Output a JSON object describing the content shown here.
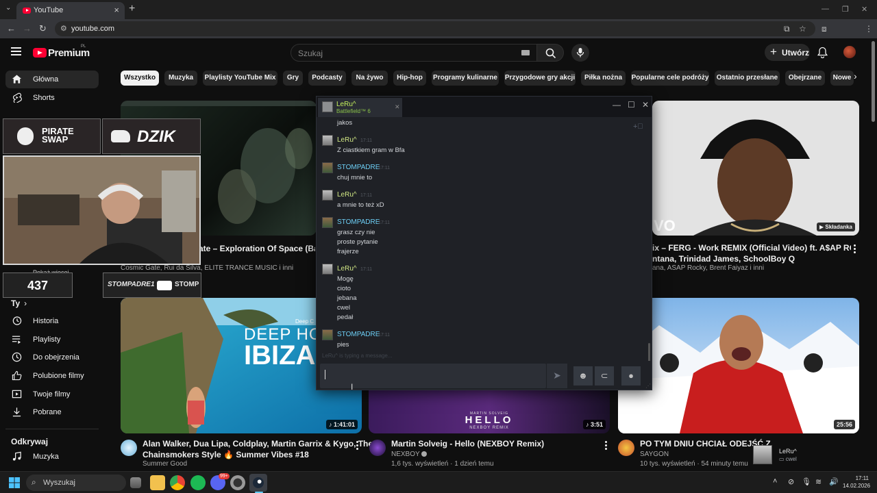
{
  "browser": {
    "tab_title": "YouTube",
    "url": "youtube.com"
  },
  "yt": {
    "premium_label": "Premium",
    "region": "PL",
    "search_placeholder": "Szukaj",
    "create_label": "Utwórz",
    "accent": "#ff0033"
  },
  "sidebar": {
    "top": [
      {
        "label": "Główna",
        "icon": "home-icon"
      },
      {
        "label": "Shorts",
        "icon": "shorts-icon"
      }
    ],
    "show_more": "Pokaż więcej",
    "you_heading": "Ty",
    "you_items": [
      {
        "label": "Historia",
        "icon": "history-icon"
      },
      {
        "label": "Playlisty",
        "icon": "playlists-icon"
      },
      {
        "label": "Do obejrzenia",
        "icon": "watch-later-icon"
      },
      {
        "label": "Polubione filmy",
        "icon": "like-icon"
      },
      {
        "label": "Twoje filmy",
        "icon": "your-videos-icon"
      },
      {
        "label": "Pobrane",
        "icon": "download-icon"
      }
    ],
    "explore_heading": "Odkrywaj",
    "explore_items": [
      {
        "label": "Muzyka",
        "icon": "music-icon"
      }
    ]
  },
  "chips": [
    "Wszystko",
    "Muzyka",
    "Playlisty YouTube Mix",
    "Gry",
    "Podcasty",
    "Na żywo",
    "Hip-hop",
    "Programy kulinarne",
    "Przygodowe gry akcji",
    "Piłka nożna",
    "Popularne cele podróży",
    "Ostatnio przesłane",
    "Obejrzane",
    "Nowe"
  ],
  "videos": {
    "v1": {
      "title_partial": "ate – Exploration Of Space (Bass S",
      "meta": "Cosmic Gate, Rui da Silva, ELITE TRANCE MUSIC i inni"
    },
    "v3": {
      "title_line1": "ix – FERG - Work REMIX (Official Video) ft. A$AP ROCKY,",
      "title_line2": "ntana, Trinidad James, SchoolBoy Q",
      "meta": "ana, ASAP Rocky, Brent Faiyaz i inni",
      "badge": "Składanka",
      "thumb_text": "VO"
    },
    "v4": {
      "title_line1": "Alan Walker, Dua Lipa, Coldplay, Martin Garrix & Kygo, The",
      "title_line2": "Chainsmokers Style 🔥 Summer Vibes #18",
      "channel": "Summer Good",
      "duration": "1:41:01",
      "thumb_top": "DEEP HOU",
      "thumb_big": "IBIZA",
      "thumb_small": "Deep C"
    },
    "v5": {
      "title": "Martin Solveig - Hello (NEXBOY Remix)",
      "channel": "NEXBOY",
      "stats": "1,6 tys. wyświetleń · 1 dzień temu",
      "duration": "3:51",
      "thumb_artist": "MARTIN SOLVEIG",
      "thumb_title": "HELLO",
      "thumb_sub": "NEXBOY REMIX"
    },
    "v6": {
      "title": "PO TYM DNIU CHCIAŁ ODEJŚĆ Z",
      "channel": "SAYGON",
      "stats": "10 tys. wyświetleń · 54 minuty temu",
      "duration": "25:56"
    }
  },
  "overlay": {
    "brand1_line1": "PIRATE",
    "brand1_line2": "SWAP",
    "brand2": "DZIK",
    "counter": "437",
    "channel": "STOMPADRE1",
    "yt_short": "STOMP"
  },
  "steam": {
    "friend_name": "LeRu^",
    "friend_game": "Battlefield™ 6",
    "messages": [
      {
        "sender": "",
        "time": "",
        "lines": [
          "jakos"
        ],
        "who": "none"
      },
      {
        "sender": "LeRu^",
        "time": "17:11",
        "lines": [
          "Z ciastkiem gram w Bfa"
        ],
        "who": "leru"
      },
      {
        "sender": "STOMPADRE",
        "time": "17:11",
        "lines": [
          "chuj mnie to"
        ],
        "who": "stomp"
      },
      {
        "sender": "LeRu^",
        "time": "17:11",
        "lines": [
          "a mnie to też xD"
        ],
        "who": "leru"
      },
      {
        "sender": "STOMPADRE",
        "time": "17:11",
        "lines": [
          "grasz czy nie",
          "proste pytanie",
          "frajerze"
        ],
        "who": "stomp"
      },
      {
        "sender": "LeRu^",
        "time": "17:11",
        "lines": [
          "Mogę",
          "cioto",
          "jebana",
          "cwel",
          "pedał"
        ],
        "who": "leru"
      },
      {
        "sender": "STOMPADRE",
        "time": "17:11",
        "lines": [
          "pies"
        ],
        "who": "stomp"
      }
    ],
    "typing": "LeRu^ is typing a message..."
  },
  "notification": {
    "name": "LeRu^",
    "text": "cwel"
  },
  "taskbar": {
    "search": "Wyszukaj",
    "time": "17:11",
    "date": "14.02.2026",
    "badge": "99+"
  }
}
